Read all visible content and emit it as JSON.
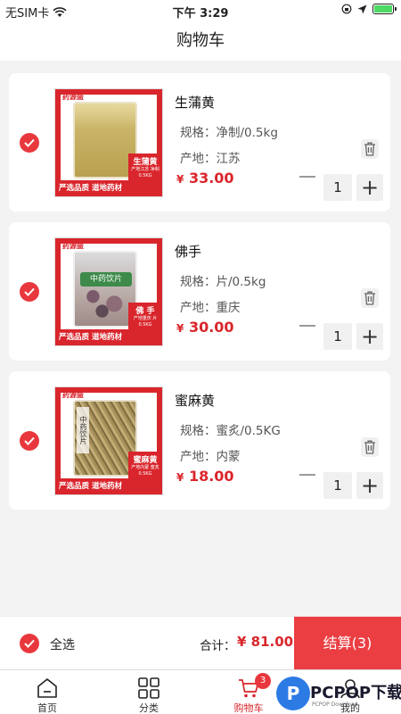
{
  "status_bar": {
    "carrier": "无SIM卡",
    "time": "下午 3:29"
  },
  "header": {
    "title": "购物车"
  },
  "cart": {
    "items": [
      {
        "name": "生蒲黄",
        "spec": "规格：净制/0.5kg",
        "origin": "产地：江苏",
        "currency": "¥",
        "price": "33.00",
        "quantity": "1",
        "package_brand": "药源盛",
        "package_tag": "生蒲黄",
        "package_tag_sub": "产地江苏 净制0.5KG",
        "package_slogan": "严选品质  道地药材"
      },
      {
        "name": "佛手",
        "spec": "规格：片/0.5kg",
        "origin": "产地：重庆",
        "currency": "¥",
        "price": "30.00",
        "quantity": "1",
        "package_brand": "药源盛",
        "package_label": "中药饮片",
        "package_tag": "佛 手",
        "package_tag_sub": "产地重庆 片0.5KG",
        "package_slogan": "严选品质  道地药材"
      },
      {
        "name": "蜜麻黄",
        "spec": "规格：蜜炙/0.5KG",
        "origin": "产地：内蒙",
        "currency": "¥",
        "price": "18.00",
        "quantity": "1",
        "package_brand": "药源盛",
        "package_label": "中药饮片",
        "package_tag": "蜜麻黄",
        "package_tag_sub": "产地内蒙 蜜炙0.5KG",
        "package_slogan": "严选品质  道地药材"
      }
    ]
  },
  "checkout": {
    "select_all": "全选",
    "total_label": "合计：",
    "total_currency": "¥",
    "total": "81.00",
    "button": "结算(3)"
  },
  "tabs": [
    {
      "label": "首页",
      "icon": "home-icon"
    },
    {
      "label": "分类",
      "icon": "grid-icon"
    },
    {
      "label": "购物车",
      "icon": "cart-icon",
      "badge": "3",
      "active": true
    },
    {
      "label": "我的",
      "icon": "user-icon"
    }
  ],
  "watermark": {
    "text": "PCPOP下载",
    "sub": "PCPOP Download",
    "letter": "P"
  },
  "colors": {
    "accent": "#e8383d",
    "price": "#d9262c",
    "checkout_button": "#ea3e43"
  }
}
